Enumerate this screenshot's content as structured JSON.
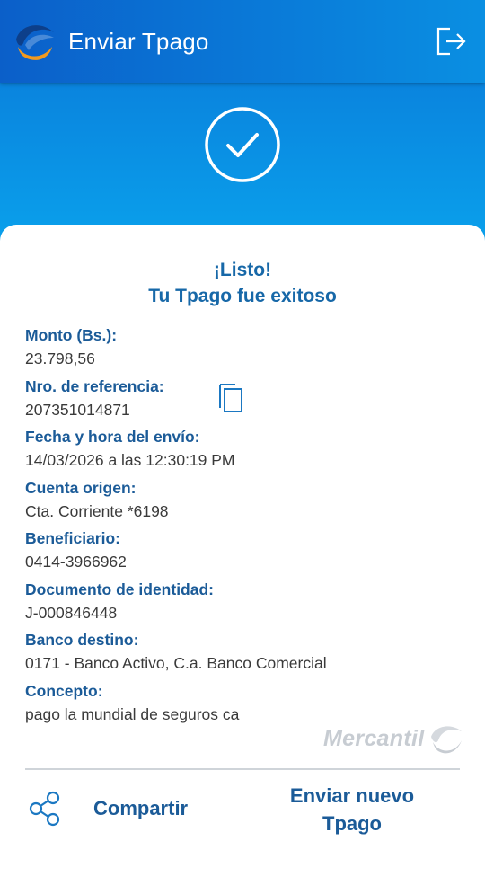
{
  "header": {
    "title": "Enviar Tpago",
    "logo_icon": "mercantil-swoosh-logo",
    "logout_icon": "logout-icon"
  },
  "status": {
    "icon": "check-circle-icon",
    "line1": "¡Listo!",
    "line2": "Tu Tpago fue exitoso"
  },
  "details": [
    {
      "label": "Monto (Bs.):",
      "value": "23.798,56"
    },
    {
      "label": "Nro. de referencia:",
      "value": "207351014871"
    },
    {
      "label": "Fecha y hora del envío:",
      "value": "14/03/2026 a las 12:30:19 PM"
    },
    {
      "label": "Cuenta origen:",
      "value": "Cta. Corriente *6198"
    },
    {
      "label": "Beneficiario:",
      "value": "0414-3966962"
    },
    {
      "label": "Documento de identidad:",
      "value": "J-000846448"
    },
    {
      "label": "Banco destino:",
      "value": "0171 - Banco Activo, C.a. Banco Comercial"
    },
    {
      "label": "Concepto:",
      "value": "pago la mundial de seguros ca"
    }
  ],
  "copy_icon": "copy-icon",
  "brand": {
    "text": "Mercantil"
  },
  "actions": {
    "share_label": "Compartir",
    "share_icon": "share-icon",
    "new_line1": "Enviar nuevo",
    "new_line2": "Tpago"
  },
  "colors": {
    "topbar": "#0b5fc9",
    "hero": "#0aa2ec",
    "accent_text": "#1b5b98",
    "logo_orange": "#f39a1e"
  }
}
